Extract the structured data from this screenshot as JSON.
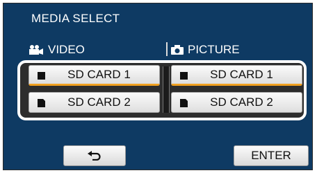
{
  "screen": {
    "title": "MEDIA SELECT"
  },
  "columns": {
    "video": {
      "label": "VIDEO",
      "icon": "movie-camera-icon"
    },
    "picture": {
      "label": "PICTURE",
      "icon": "camera-icon"
    }
  },
  "video_options": [
    {
      "label": "SD CARD 1",
      "icon": "sd-card-icon"
    },
    {
      "label": "SD CARD 2",
      "icon": "sd-card-icon"
    }
  ],
  "picture_options": [
    {
      "label": "SD CARD 1",
      "icon": "sd-card-icon"
    },
    {
      "label": "SD CARD 2",
      "icon": "sd-card-icon"
    }
  ],
  "footer": {
    "back_icon": "return-arrow-icon",
    "enter_label": "ENTER"
  },
  "colors": {
    "background": "#0e3a63",
    "selection_accent": "#f0a020",
    "button_face": "#f0f0f0"
  }
}
